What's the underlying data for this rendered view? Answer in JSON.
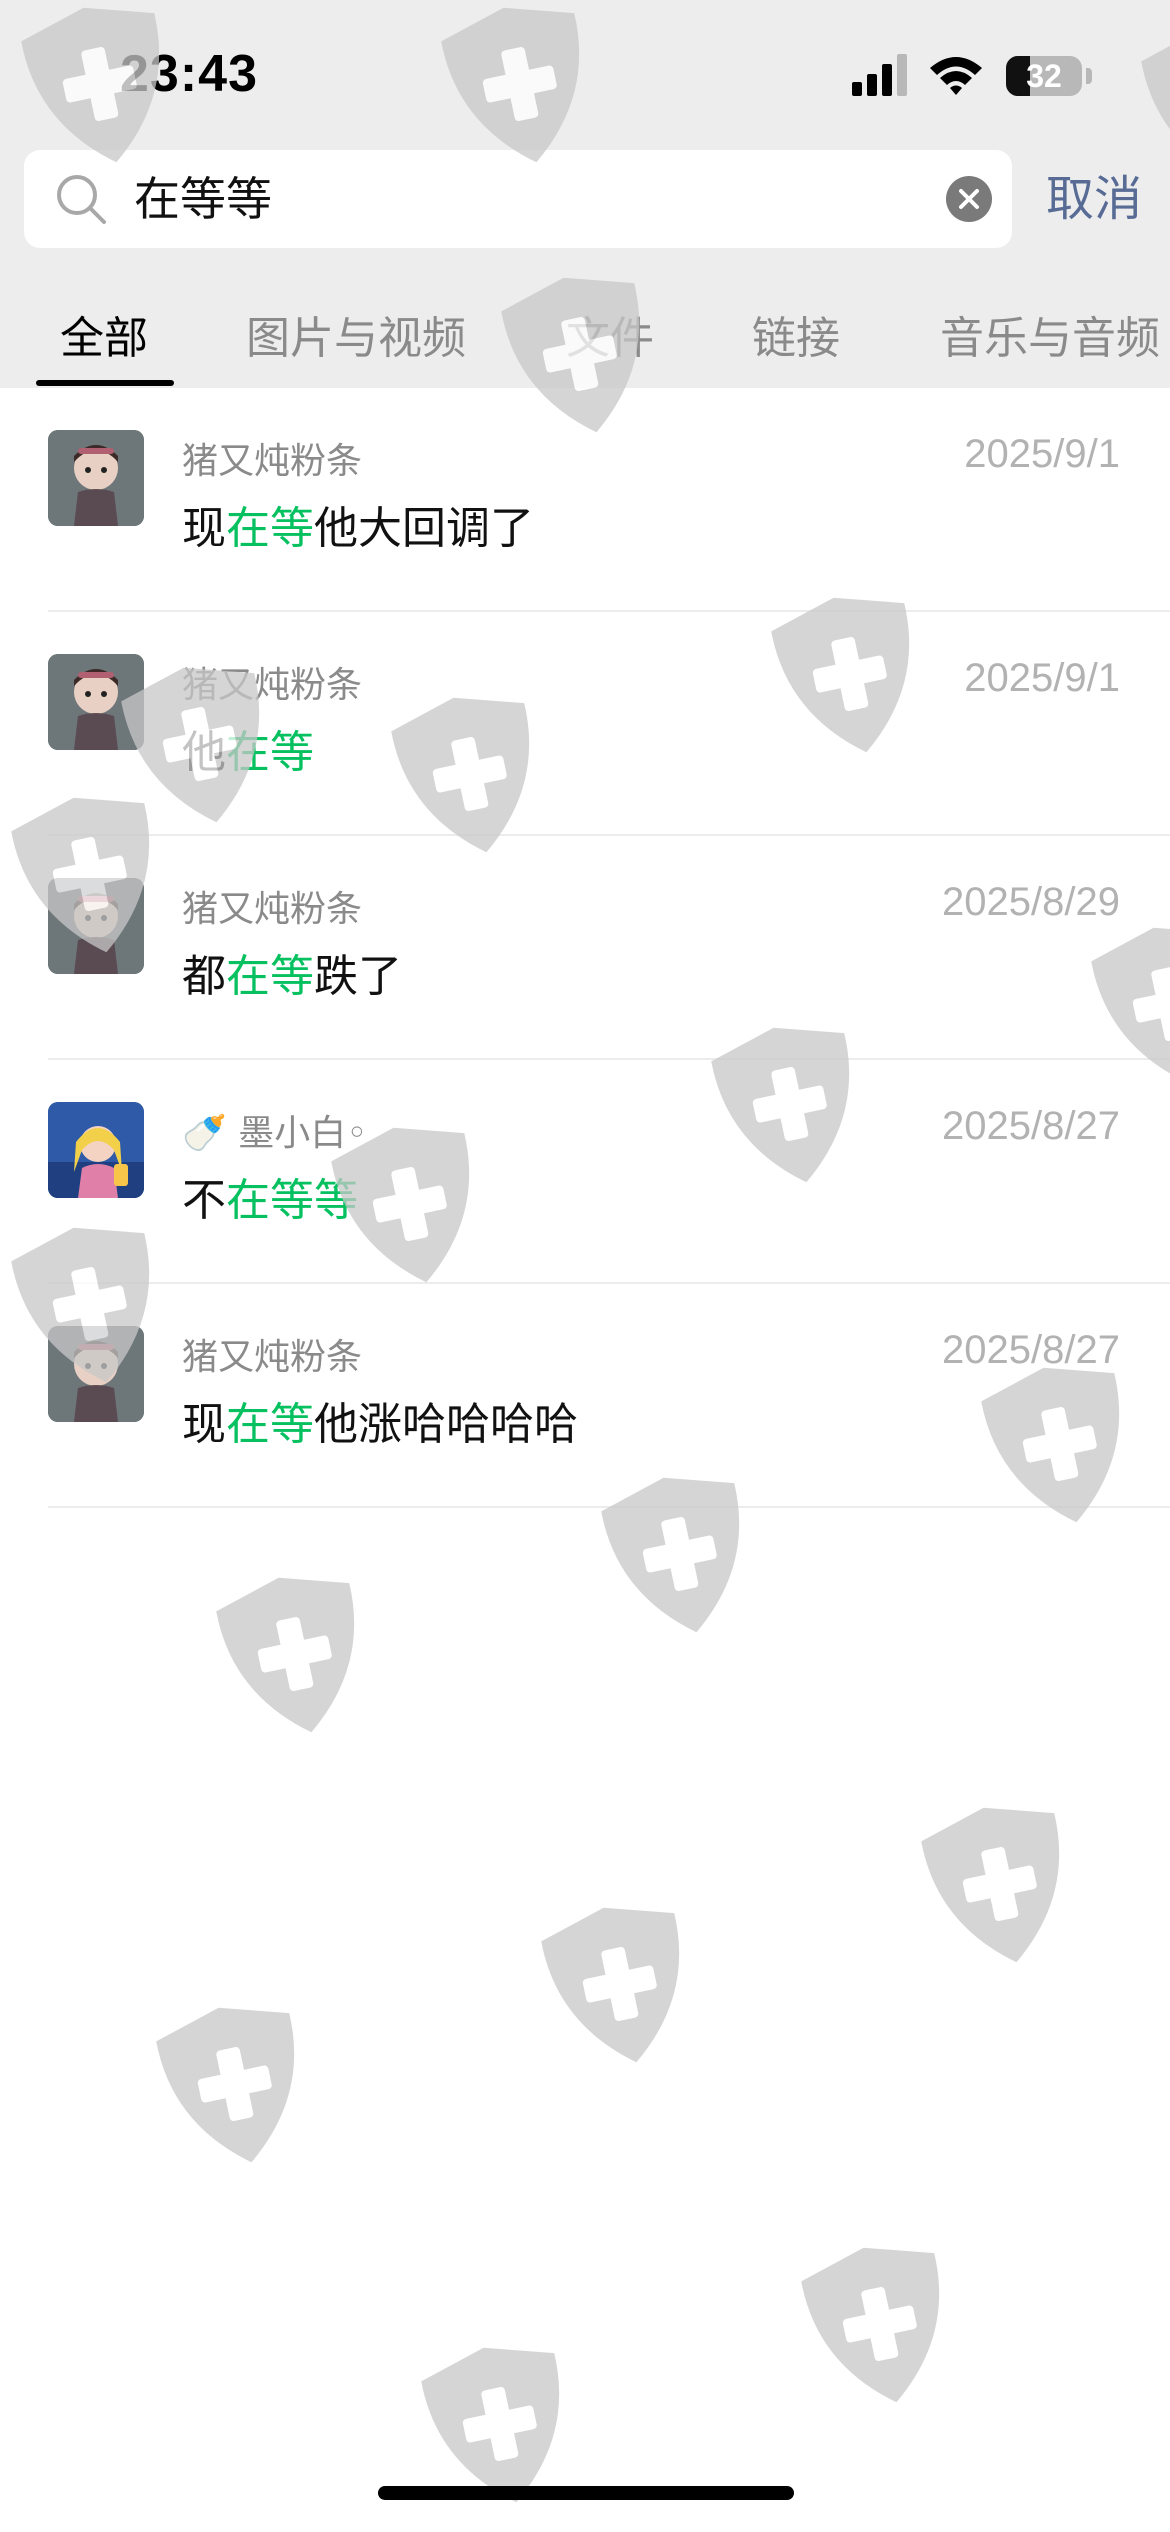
{
  "status_bar": {
    "time": "23:43",
    "battery": "32",
    "battery_level": 0.32
  },
  "search": {
    "query": "在等等",
    "cancel_label": "取消"
  },
  "tabs": [
    {
      "label": "全部",
      "active": true
    },
    {
      "label": "图片与视频",
      "active": false
    },
    {
      "label": "文件",
      "active": false
    },
    {
      "label": "链接",
      "active": false
    },
    {
      "label": "音乐与音频",
      "active": false
    }
  ],
  "results": [
    {
      "sender": "猪又炖粉条",
      "date": "2025/9/1",
      "before": "现",
      "match": "在等",
      "after": "他大回调了",
      "avatar": "doll-avatar"
    },
    {
      "sender": "猪又炖粉条",
      "date": "2025/9/1",
      "before": "他",
      "match": "在等",
      "after": "",
      "avatar": "doll-avatar"
    },
    {
      "sender": "猪又炖粉条",
      "date": "2025/8/29",
      "before": "都",
      "match": "在等",
      "after": "跌了",
      "avatar": "doll-avatar"
    },
    {
      "sender": "🍼 墨小白◦",
      "date": "2025/8/27",
      "before": "不",
      "match": "在等等",
      "after": "",
      "avatar": "anime-girl-avatar"
    },
    {
      "sender": "猪又炖粉条",
      "date": "2025/8/27",
      "before": "现",
      "match": "在等",
      "after": "他涨哈哈哈哈",
      "avatar": "doll-avatar"
    }
  ],
  "colors": {
    "highlight": "#07c160",
    "link": "#576b95",
    "watermark": "#c8c8c8"
  }
}
